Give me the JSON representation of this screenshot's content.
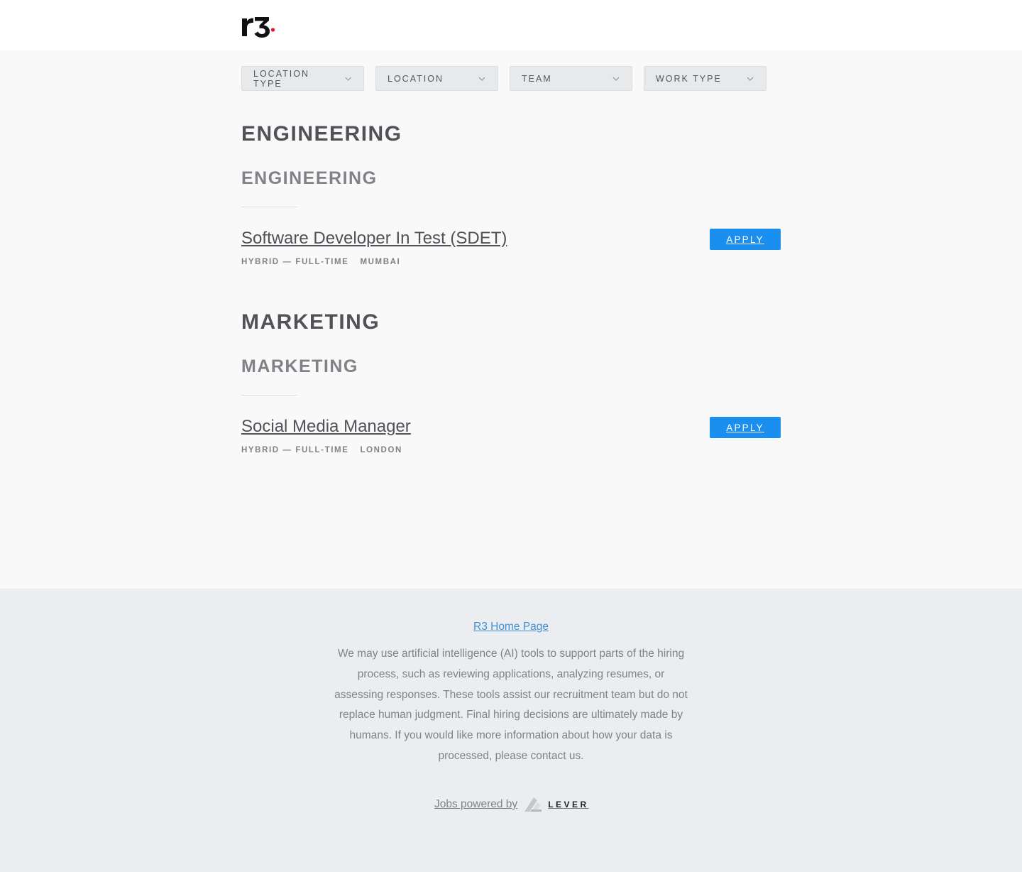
{
  "header": {
    "logo_text": "r3."
  },
  "filters": [
    {
      "label": "LOCATION TYPE"
    },
    {
      "label": "LOCATION"
    },
    {
      "label": "TEAM"
    },
    {
      "label": "WORK TYPE"
    }
  ],
  "sections": [
    {
      "title": "ENGINEERING",
      "group": "ENGINEERING",
      "posting": {
        "title": "Software Developer In Test (SDET)",
        "commitment": "HYBRID — FULL-TIME",
        "location": "MUMBAI",
        "apply_label": "APPLY"
      }
    },
    {
      "title": "MARKETING",
      "group": "MARKETING",
      "posting": {
        "title": "Social Media Manager",
        "commitment": "HYBRID — FULL-TIME",
        "location": "LONDON",
        "apply_label": "APPLY"
      }
    }
  ],
  "footer": {
    "home_link": "R3 Home Page",
    "disclaimer": "We may use artificial intelligence (AI) tools to support parts of the hiring process, such as reviewing applications, analyzing resumes, or assessing responses. These tools assist our recruitment team but do not replace human judgment. Final hiring decisions are ultimately made by humans. If you would like more information about how your data is processed, please contact us.",
    "powered_by": "Jobs powered by",
    "lever_word": "LEVER"
  },
  "colors": {
    "accent": "#1a8ff0",
    "logo_dot": "#e8142c"
  }
}
